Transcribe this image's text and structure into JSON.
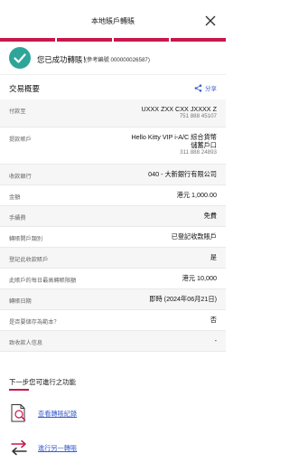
{
  "header": {
    "title": "本地賬戶轉賬"
  },
  "success": {
    "message": "您已成功轉賬！",
    "reference": "(參考編號 000000026587)"
  },
  "overview": {
    "title": "交易概要",
    "share_label": "分享"
  },
  "details": [
    {
      "label": "付款至",
      "value": "UXXX ZXX CXX JXXXX Z",
      "sub": "751 888 45107"
    },
    {
      "label": "提款賬戶",
      "value": "Hello Kitty VIP i-A/C 綜合貨幣",
      "value2": "儲蓄戶口",
      "sub": "311 888 24893"
    },
    {
      "label": "收款銀行",
      "value": "040 - 大新銀行有限公司"
    },
    {
      "label": "金額",
      "value": "港元 1,000.00"
    },
    {
      "label": "手續費",
      "value": "免費"
    },
    {
      "label": "轉賬開戶類別",
      "value": "已登記收款賬戶"
    },
    {
      "label": "登記此收款賬戶",
      "value": "是"
    },
    {
      "label": "此賬戶的每日最高轉賬限額",
      "value": "港元  10,000"
    },
    {
      "label": "轉賬日期",
      "value": "即時 (2024年06月21日)"
    },
    {
      "label": "是否要儲存為範本？",
      "value": "否"
    },
    {
      "label": "致收款人信息",
      "value": "-"
    }
  ],
  "next_steps": {
    "title": "下一步您可進行之功能",
    "actions": [
      {
        "label": "查看轉賬紀錄",
        "icon": "search-document-icon"
      },
      {
        "label": "進行另一轉賬",
        "icon": "transfer-arrows-icon"
      }
    ]
  },
  "colors": {
    "brand": "#c8184b",
    "success": "#2fa59a",
    "link": "#3a5fcd"
  }
}
